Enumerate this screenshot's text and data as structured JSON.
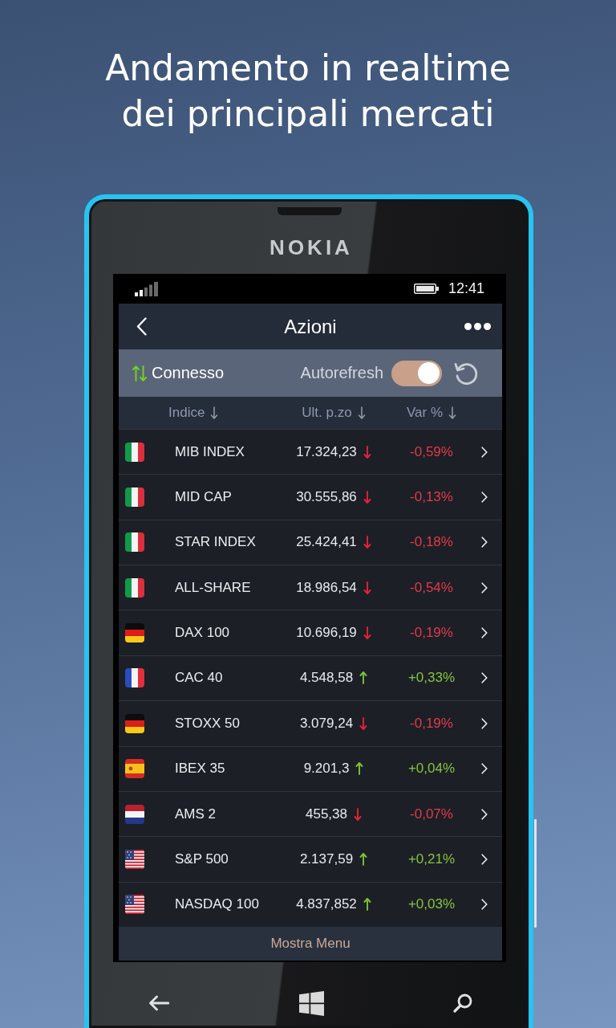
{
  "headline": {
    "lines": [
      "Andamento in realtime",
      "dei principali mercati"
    ]
  },
  "device": {
    "brand": "NOKIA"
  },
  "status_bar": {
    "time": "12:41"
  },
  "app_bar": {
    "title": "Azioni"
  },
  "connection_bar": {
    "status": "Connesso",
    "autorefresh_label": "Autorefresh",
    "autorefresh_on": true
  },
  "table": {
    "columns": [
      {
        "label": "Indice"
      },
      {
        "label": "Ult. p.zo"
      },
      {
        "label": "Var %"
      }
    ],
    "rows": [
      {
        "kind": "italy",
        "name": "MIB INDEX",
        "price": "17.324,23",
        "rising": false,
        "change": "-0,59%"
      },
      {
        "kind": "italy",
        "name": "MID CAP",
        "price": "30.555,86",
        "rising": false,
        "change": "-0,13%"
      },
      {
        "kind": "italy",
        "name": "STAR INDEX",
        "price": "25.424,41",
        "rising": false,
        "change": "-0,18%"
      },
      {
        "kind": "italy",
        "name": "ALL-SHARE",
        "price": "18.986,54",
        "rising": false,
        "change": "-0,54%"
      },
      {
        "kind": "germany",
        "name": "DAX 100",
        "price": "10.696,19",
        "rising": false,
        "change": "-0,19%"
      },
      {
        "kind": "france",
        "name": "CAC 40",
        "price": "4.548,58",
        "rising": true,
        "change": "+0,33%"
      },
      {
        "kind": "germany",
        "name": "STOXX 50",
        "price": "3.079,24",
        "rising": false,
        "change": "-0,19%"
      },
      {
        "kind": "spain",
        "name": "IBEX 35",
        "price": "9.201,3",
        "rising": true,
        "change": "+0,04%"
      },
      {
        "kind": "netherlands",
        "name": "AMS 2",
        "price": "455,38",
        "rising": false,
        "change": "-0,07%"
      },
      {
        "kind": "usa",
        "name": "S&P 500",
        "price": "2.137,59",
        "rising": true,
        "change": "+0,21%"
      },
      {
        "kind": "usa",
        "name": "NASDAQ 100",
        "price": "4.837,852",
        "rising": true,
        "change": "+0,03%"
      }
    ]
  },
  "footer": {
    "label": "Mostra Menu"
  }
}
